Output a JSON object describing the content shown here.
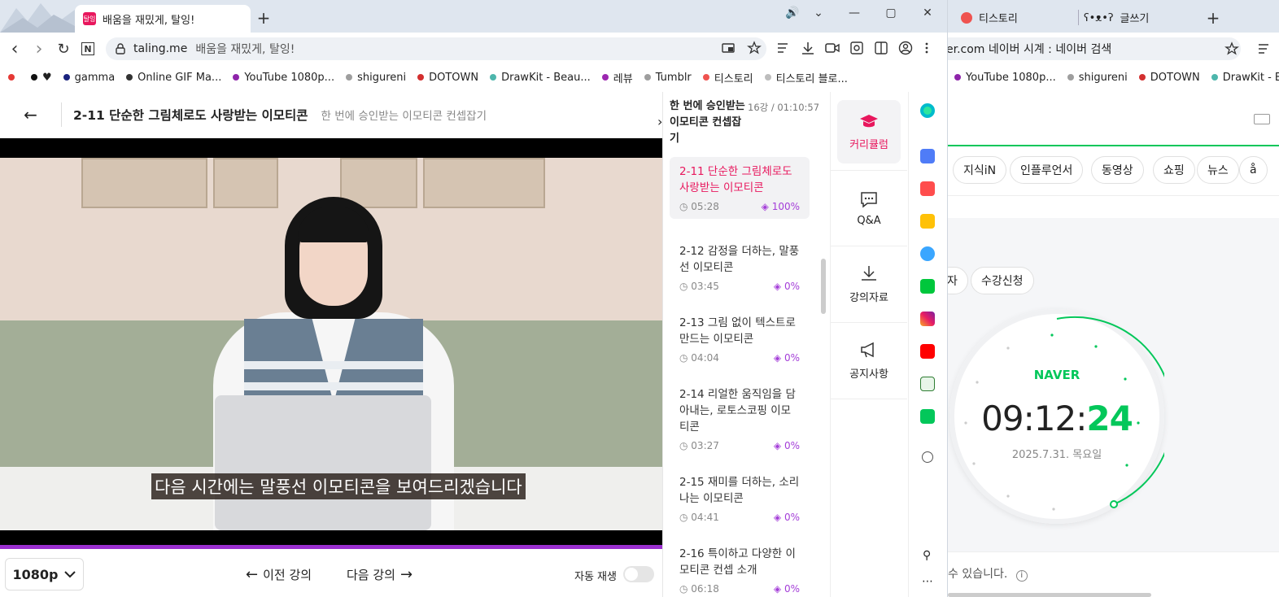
{
  "left_window": {
    "tab": {
      "favicon_text": "탈잉",
      "title": "배움을 재밌게, 탈잉!"
    },
    "new_tab": "+",
    "window_controls": {
      "sound": "🔊",
      "dropdown": "⌄",
      "minimize": "—",
      "maximize": "▢",
      "close": "✕"
    },
    "toolbar": {
      "back": "‹",
      "forward": "›",
      "reload": "↻",
      "n": "N"
    },
    "address": {
      "domain": "taling.me",
      "page_title": "배움을 재밌게, 탈잉!"
    },
    "bookmarks": [
      {
        "label": "",
        "color": "#e53935"
      },
      {
        "label": "♥",
        "color": "#111111"
      },
      {
        "label": "gamma",
        "color": "#1a237e"
      },
      {
        "label": "Online GIF Ma...",
        "color": "#333333"
      },
      {
        "label": "YouTube 1080p...",
        "color": "#8e24aa"
      },
      {
        "label": "shigureni",
        "color": "#9e9e9e"
      },
      {
        "label": "DOTOWN",
        "color": "#d32f2f"
      },
      {
        "label": "DrawKit - Beau...",
        "color": "#4db6ac"
      },
      {
        "label": "레뷰",
        "color": "#9c27b0"
      },
      {
        "label": "Tumblr",
        "color": "#9e9e9e"
      },
      {
        "label": "티스토리",
        "color": "#ef5350"
      },
      {
        "label": "티스토리 블로...",
        "color": "#bdbdbd"
      }
    ],
    "lecture": {
      "back_icon": "←",
      "title": "2-11 단순한 그림체로도 사랑받는 이모티콘",
      "course": "한 번에 승인받는 이모티콘 컨셉잡기",
      "subtitle": "다음 시간에는 말풍선 이모티콘을 보여드리겠습니다",
      "quality": "1080p",
      "prev": "이전 강의",
      "next": "다음 강의",
      "autoplay": "자동 재생"
    },
    "curriculum": {
      "course_title": "한 번에 승인받는 이모티콘 컨셉잡기",
      "meta": "16강 / 01:10:57",
      "items": [
        {
          "title": "2-11 단순한 그림체로도 사랑받는 이모티콘",
          "time": "05:28",
          "progress": "100%",
          "active": true
        },
        {
          "title": "2-12 감정을 더하는, 말풍선 이모티콘",
          "time": "03:45",
          "progress": "0%"
        },
        {
          "title": "2-13 그림 없이 텍스트로 만드는 이모티콘",
          "time": "04:04",
          "progress": "0%"
        },
        {
          "title": "2-14 리얼한 움직임을 담아내는, 로토스코핑 이모티콘",
          "time": "03:27",
          "progress": "0%"
        },
        {
          "title": "2-15 재미를 더하는, 소리나는 이모티콘",
          "time": "04:41",
          "progress": "0%"
        },
        {
          "title": "2-16 특이하고 다양한 이모티콘 컨셉 소개",
          "time": "06:18",
          "progress": "0%"
        }
      ]
    },
    "side_nav": [
      {
        "label": "커리큘럼",
        "icon": "graduation-cap"
      },
      {
        "label": "Q&A",
        "icon": "chat-bubble"
      },
      {
        "label": "강의자료",
        "icon": "download"
      },
      {
        "label": "공지사항",
        "icon": "megaphone"
      }
    ]
  },
  "right_window": {
    "tabs": [
      {
        "title": "티스토리"
      },
      {
        "title": "글쓰기"
      }
    ],
    "new_tab": "+",
    "address": {
      "text": "er.com  네이버 시계 : 네이버 검색"
    },
    "bookmarks": [
      {
        "label": "YouTube 1080p...",
        "color": "#8e24aa"
      },
      {
        "label": "shigureni",
        "color": "#9e9e9e"
      },
      {
        "label": "DOTOWN",
        "color": "#d32f2f"
      },
      {
        "label": "DrawKit - Beau...",
        "color": "#4db6ac"
      }
    ],
    "search_tabs": [
      "지식iN",
      "인플루언서",
      "동영상",
      "쇼핑",
      "뉴스",
      "å"
    ],
    "chip_left": "자",
    "chip_apply": "수강신청",
    "clock": {
      "brand": "NAVER",
      "hm": "09:12:",
      "sec": "24",
      "date": "2025.7.31. 목요일"
    },
    "footer_text": "수 있습니다."
  },
  "colors": {
    "accent": "#e8175d",
    "purple": "#a43ed8",
    "naver": "#03c75a"
  }
}
